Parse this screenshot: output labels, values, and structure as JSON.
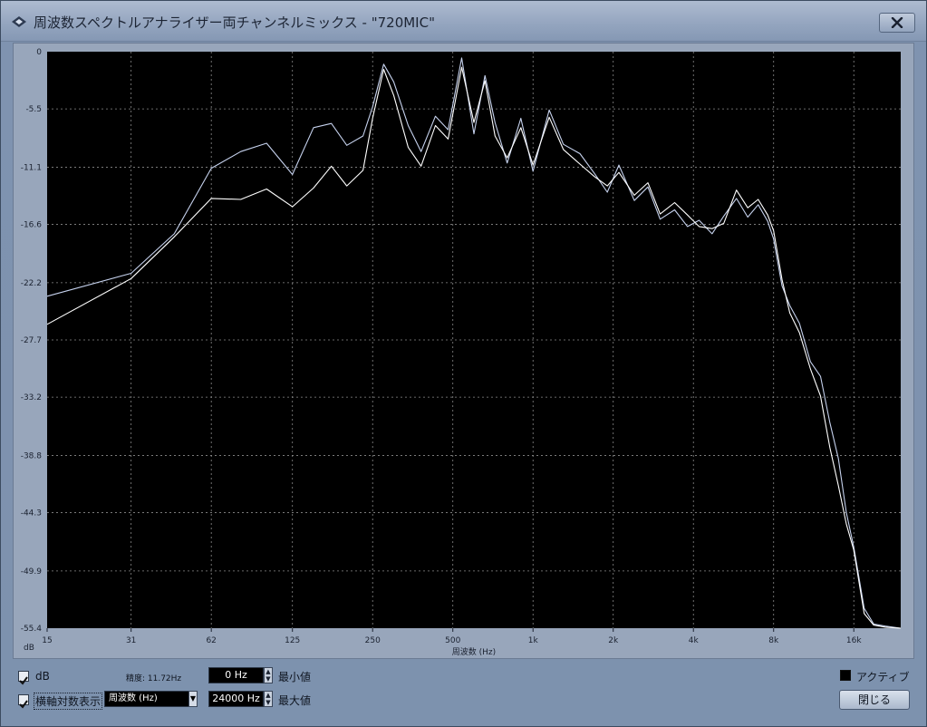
{
  "window": {
    "title": "周波数スペクトルアナライザー両チャンネルミックス - \"720MIC\"",
    "close_icon": "close-x-icon"
  },
  "chart_data": {
    "type": "line",
    "x_scale": "log",
    "x_ticks": [
      15,
      31,
      62,
      125,
      250,
      500,
      1000,
      2000,
      4000,
      8000,
      16000
    ],
    "x_tick_labels": [
      "15",
      "31",
      "62",
      "125",
      "250",
      "500",
      "1k",
      "2k",
      "4k",
      "8k",
      "16k"
    ],
    "xlim": [
      15,
      24000
    ],
    "xlabel": "周波数 (Hz)",
    "y_ticks": [
      0,
      -5.5,
      -11.1,
      -16.6,
      -22.2,
      -27.7,
      -33.2,
      -38.8,
      -44.3,
      -49.9,
      -55.4
    ],
    "y_tick_labels": [
      "0",
      "-5.5",
      "-11.1",
      "-16.6",
      "-22.2",
      "-27.7",
      "-33.2",
      "-38.8",
      "-44.3",
      "-49.9",
      "-55.4"
    ],
    "ylim": [
      -55.4,
      0
    ],
    "ylabel": "dB",
    "grid": true,
    "background": "#000000",
    "series": [
      {
        "color": "#c6d2ee",
        "x": [
          15,
          31,
          45,
          62,
          80,
          100,
          125,
          150,
          175,
          200,
          230,
          250,
          275,
          300,
          340,
          380,
          430,
          480,
          540,
          600,
          660,
          720,
          800,
          900,
          1000,
          1150,
          1300,
          1500,
          1700,
          1900,
          2100,
          2400,
          2700,
          3000,
          3400,
          3800,
          4200,
          4700,
          5200,
          5800,
          6400,
          7000,
          7600,
          8000,
          8600,
          9200,
          10000,
          11000,
          12000,
          13000,
          14000,
          15000,
          16000,
          17500,
          19000,
          21000,
          24000
        ],
        "y": [
          -23.5,
          -21.3,
          -17.5,
          -11.2,
          -9.6,
          -8.8,
          -11.8,
          -7.3,
          -6.9,
          -9.0,
          -8.1,
          -5.3,
          -1.2,
          -2.9,
          -7.1,
          -9.6,
          -6.2,
          -7.5,
          -0.6,
          -7.9,
          -2.3,
          -6.8,
          -10.7,
          -6.4,
          -11.5,
          -5.6,
          -8.9,
          -9.8,
          -11.7,
          -13.5,
          -10.9,
          -14.3,
          -13.0,
          -16.1,
          -15.2,
          -16.8,
          -16.2,
          -17.5,
          -15.8,
          -14.1,
          -15.9,
          -14.7,
          -16.3,
          -18.0,
          -22.5,
          -24.4,
          -26.1,
          -29.8,
          -31.2,
          -35.6,
          -39.1,
          -44.3,
          -47.6,
          -53.5,
          -55.0,
          -55.2,
          -55.4
        ]
      },
      {
        "color": "#ffffff",
        "x": [
          15,
          31,
          45,
          62,
          80,
          100,
          125,
          150,
          175,
          200,
          230,
          250,
          275,
          300,
          340,
          380,
          430,
          480,
          540,
          600,
          660,
          720,
          800,
          900,
          1000,
          1150,
          1300,
          1500,
          1700,
          1900,
          2100,
          2400,
          2700,
          3000,
          3400,
          3800,
          4200,
          4700,
          5200,
          5800,
          6400,
          7000,
          7600,
          8000,
          8600,
          9200,
          10000,
          11000,
          12000,
          13000,
          14000,
          15000,
          16000,
          17500,
          19000,
          21000,
          24000
        ],
        "y": [
          -26.2,
          -21.8,
          -17.8,
          -14.1,
          -14.2,
          -13.2,
          -14.9,
          -13.1,
          -11.0,
          -12.9,
          -11.4,
          -6.4,
          -1.7,
          -4.2,
          -9.2,
          -11.0,
          -7.1,
          -8.4,
          -1.5,
          -6.8,
          -2.8,
          -8.1,
          -10.2,
          -7.3,
          -10.9,
          -6.3,
          -9.4,
          -10.8,
          -12.0,
          -12.9,
          -11.6,
          -13.8,
          -12.6,
          -15.6,
          -14.5,
          -15.7,
          -16.8,
          -17.0,
          -16.5,
          -13.3,
          -15.0,
          -14.2,
          -15.7,
          -17.2,
          -21.9,
          -25.1,
          -27.0,
          -30.5,
          -33.1,
          -38.0,
          -41.7,
          -45.4,
          -47.9,
          -54.0,
          -55.1,
          -55.3,
          -55.4
        ]
      }
    ]
  },
  "controls": {
    "db_checkbox_label": "dB",
    "db_checked": true,
    "resolution_label": "精度: 11.72Hz",
    "log_checkbox_label": "横軸対数表示",
    "log_checked": true,
    "axis_mode_value": "周波数 (Hz)",
    "min_value": "0 Hz",
    "min_label": "最小値",
    "max_value": "24000 Hz",
    "max_label": "最大値",
    "active_label": "アクティブ",
    "close_button_label": "閉じる"
  }
}
